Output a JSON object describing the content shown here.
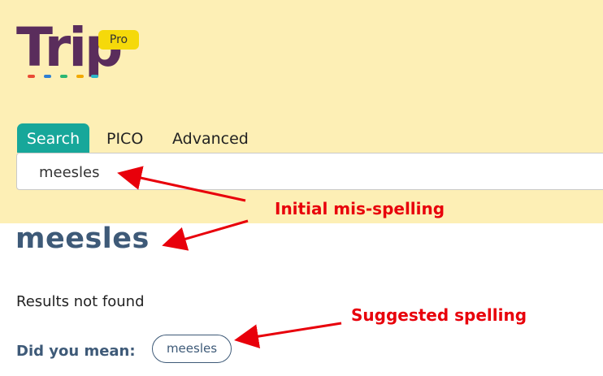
{
  "logo": {
    "text": "Trip",
    "badge": "Pro"
  },
  "tabs": [
    {
      "label": "Search",
      "active": true
    },
    {
      "label": "PICO",
      "active": false
    },
    {
      "label": "Advanced",
      "active": false
    }
  ],
  "search": {
    "value": "meesles"
  },
  "results": {
    "title": "meesles",
    "status": "Results not found",
    "did_you_mean_label": "Did you mean:",
    "suggestion": "meesles"
  },
  "annotations": {
    "initial": "Initial mis-spelling",
    "suggested": "Suggested spelling"
  },
  "colors": {
    "header_bg": "#fdefb5",
    "accent_teal": "#17a79a",
    "text_blue": "#3e5a78",
    "annotation_red": "#e8000b",
    "badge_yellow": "#f5d90a"
  }
}
